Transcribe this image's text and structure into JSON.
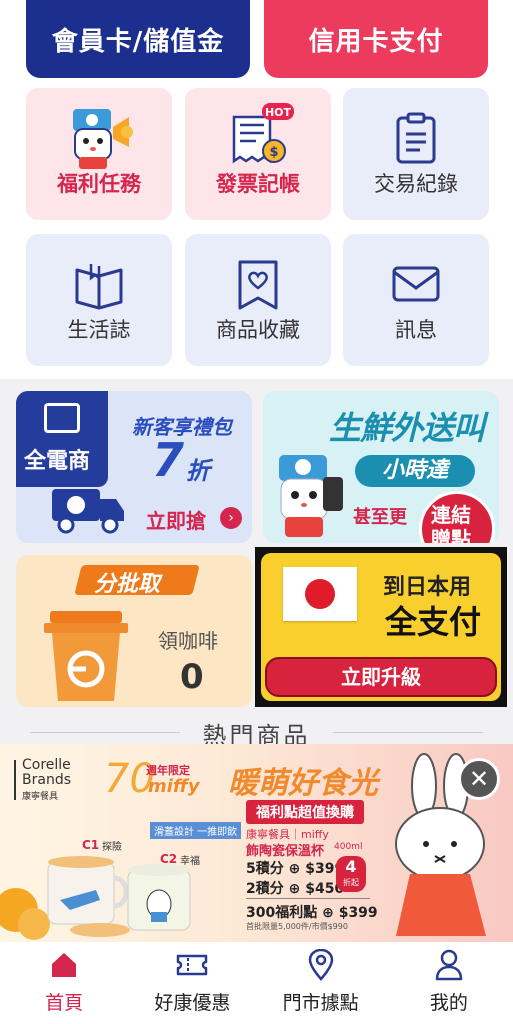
{
  "top": {
    "member_card": "會員卡/儲值金",
    "credit_card": "信用卡支付"
  },
  "grid": {
    "row1": [
      {
        "label": "福利任務",
        "icon": "mascot-megaphone-icon"
      },
      {
        "label": "發票記帳",
        "icon": "receipt-coin-icon",
        "badge": "HOT"
      },
      {
        "label": "交易紀錄",
        "icon": "clipboard-icon"
      }
    ],
    "row2": [
      {
        "label": "生活誌",
        "icon": "open-book-icon"
      },
      {
        "label": "商品收藏",
        "icon": "heart-bookmark-icon"
      },
      {
        "label": "訊息",
        "icon": "envelope-icon"
      }
    ]
  },
  "promos": {
    "ecom": {
      "brand": "全電商",
      "title": "新客享禮包",
      "discount": "7",
      "discount_unit": "折",
      "cta": "立即搶"
    },
    "fresh": {
      "title": "生鮮外送叫",
      "subtitle": "小時達",
      "tagline": "甚至更",
      "badge_line1": "連結",
      "badge_line2": "贈點"
    },
    "coffee": {
      "title": "分批取",
      "label": "領咖啡",
      "count": "0"
    },
    "japan": {
      "line1": "到日本用",
      "line2": "全支付",
      "cta": "立即升級"
    }
  },
  "hot_products": {
    "title": "熱門商品"
  },
  "banner": {
    "brand_line1": "Corelle",
    "brand_line2": "Brands",
    "brand_cn": "康寧餐具",
    "anniv": "70",
    "anniv_tag": "週年限定",
    "miffy": "miffy",
    "headline": "暖萌好食光",
    "sub": "福利點超值換購",
    "product_brand": "康寧餐具｜miffy",
    "product_name": "飾陶瓷保溫杯",
    "product_size": "400ml",
    "offer1": "5積分 ⊕ $399",
    "offer2": "2積分 ⊕ $450",
    "offer3": "300福利點 ⊕ $399",
    "offer_badge": "4",
    "offer_badge_sub": "折起",
    "fine_print": "首批限量5,000件/市價$990",
    "c1": "C1",
    "c1_label": "探險",
    "c2": "C2",
    "c2_label": "幸福",
    "feature": "滑蓋設計 一推即飲"
  },
  "nav": [
    {
      "label": "首頁",
      "icon": "home-icon",
      "active": true
    },
    {
      "label": "好康優惠",
      "icon": "ticket-icon",
      "active": false
    },
    {
      "label": "門市據點",
      "icon": "location-pin-icon",
      "active": false
    },
    {
      "label": "我的",
      "icon": "user-icon",
      "active": false
    }
  ],
  "colors": {
    "navy": "#1c2f8f",
    "pink": "#ec3b5c",
    "accent_red": "#d4264e",
    "icon_blue": "#2a3b8f",
    "japan_yellow": "#f8cf2d"
  }
}
